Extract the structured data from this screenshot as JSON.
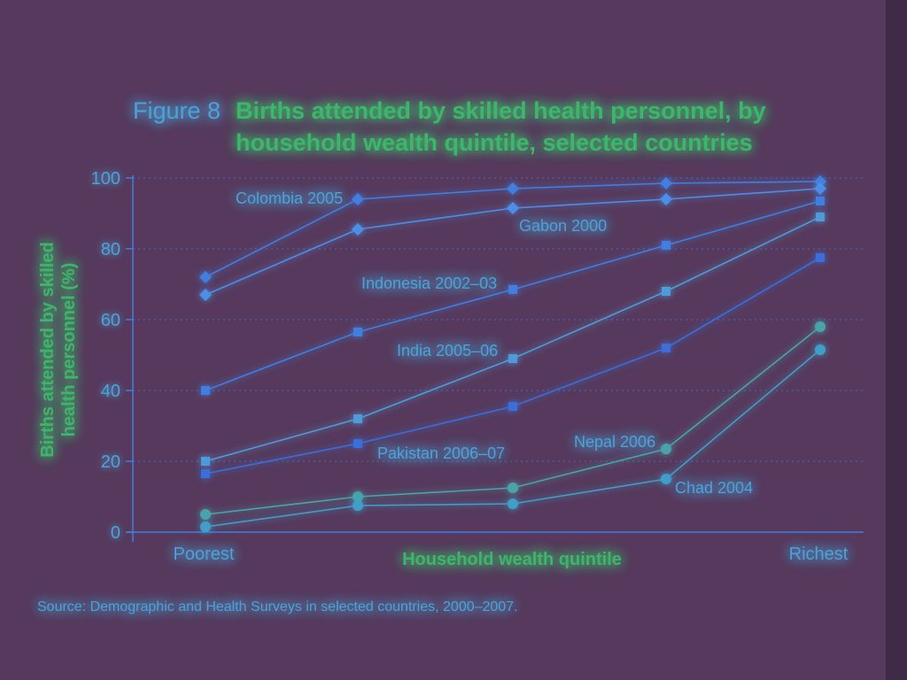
{
  "figure_number": "Figure 8",
  "title_lines": [
    "Births attended by skilled health personnel, by",
    "household wealth quintile, selected countries"
  ],
  "source": "Source: Demographic and Health Surveys in selected countries, 2000–2007.",
  "colors": {
    "background": "#56395c",
    "glow": "#2f6be0",
    "highlight": "#8df05a",
    "text": "#4aa3d8",
    "title": "#3db56b",
    "line": "#3f7fe0"
  },
  "chart_data": {
    "type": "line",
    "categories": [
      "Poorest",
      "",
      "",
      "",
      "Richest"
    ],
    "xlabel": "Household wealth quintile",
    "ylabel_lines": [
      "Births attended by skilled",
      "health personnel (%)"
    ],
    "ylim": [
      0,
      100
    ],
    "yticks": [
      "0",
      "20",
      "40",
      "60",
      "80",
      "100"
    ],
    "grid": true,
    "series": [
      {
        "name": "Colombia 2005",
        "marker": "diamond",
        "values": [
          72,
          94,
          97,
          98.5,
          99
        ]
      },
      {
        "name": "Gabon 2000",
        "marker": "diamond",
        "values": [
          67,
          85.5,
          91.5,
          94,
          97
        ]
      },
      {
        "name": "Indonesia 2002–03",
        "marker": "square",
        "values": [
          40,
          56.5,
          68.5,
          81,
          93.5
        ]
      },
      {
        "name": "India 2005–06",
        "marker": "square",
        "values": [
          20,
          32,
          49,
          68,
          89
        ]
      },
      {
        "name": "Pakistan 2006–07",
        "marker": "square",
        "values": [
          16.5,
          25,
          35.5,
          52,
          77.5
        ]
      },
      {
        "name": "Nepal 2006",
        "marker": "circle",
        "values": [
          5,
          10,
          12.5,
          23.5,
          58
        ]
      },
      {
        "name": "Chad 2004",
        "marker": "circle",
        "values": [
          1.5,
          7.5,
          8,
          15,
          51.5
        ]
      }
    ]
  }
}
